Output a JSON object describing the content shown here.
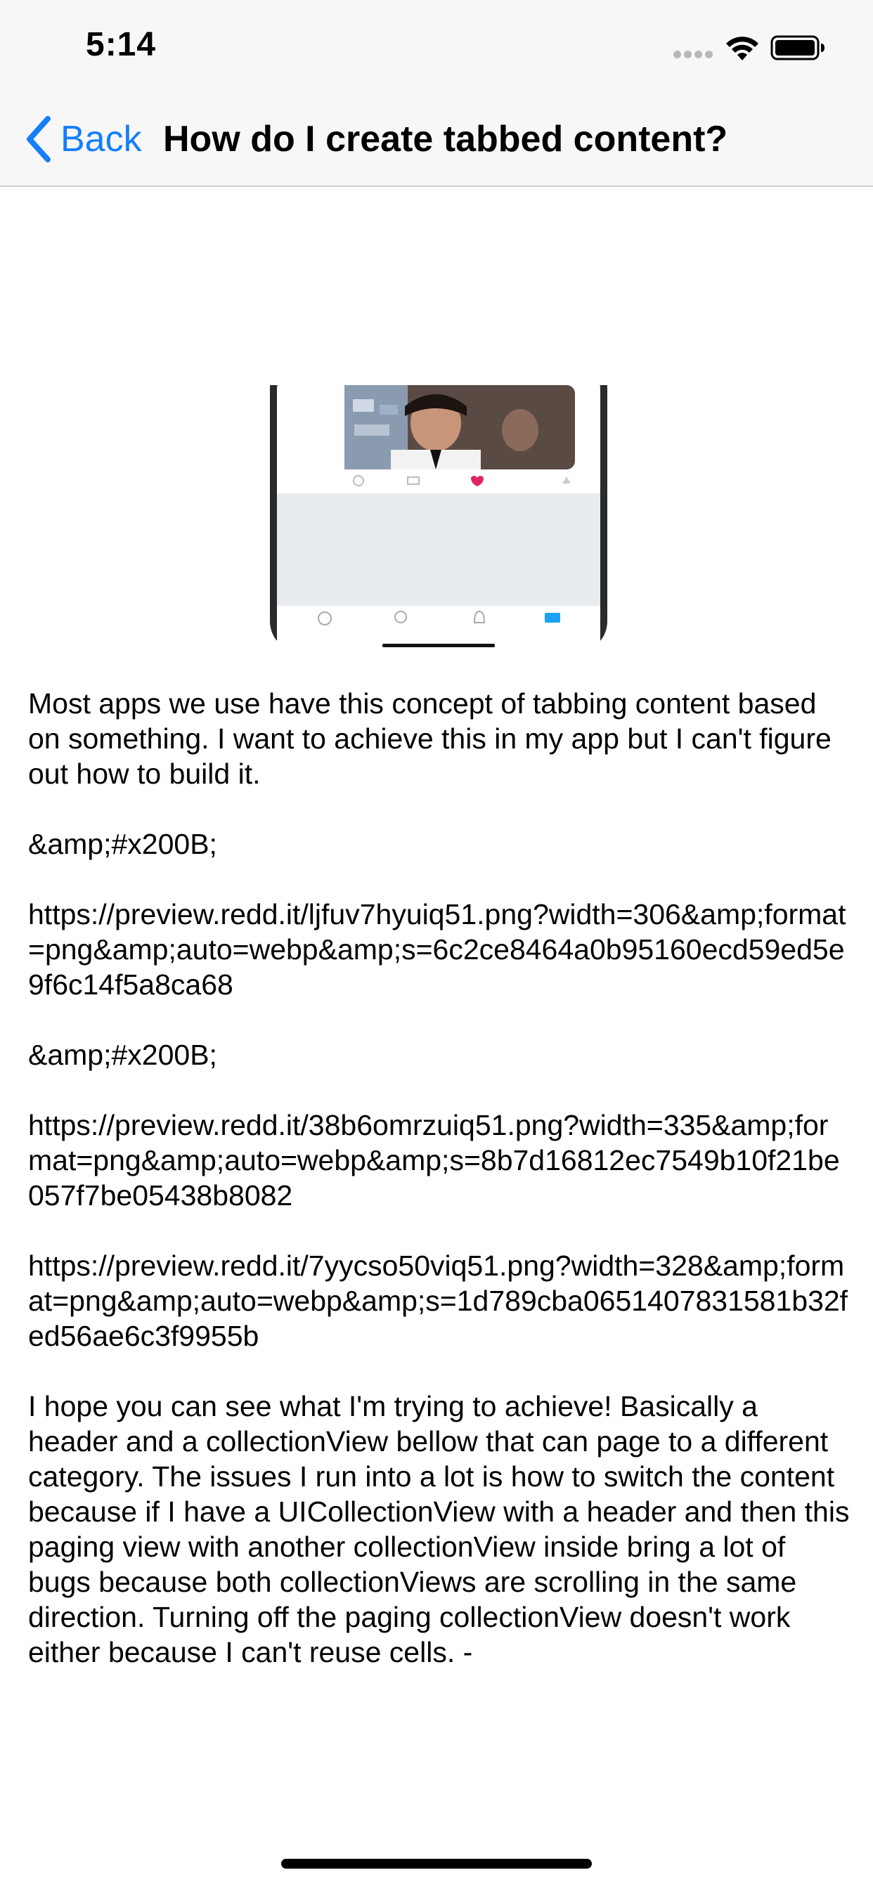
{
  "status_bar": {
    "time": "5:14",
    "icons": [
      "signal-dots-icon",
      "wifi-icon",
      "battery-icon"
    ]
  },
  "nav": {
    "back_label": "Back",
    "title": "How do I create tabbed content?",
    "accent_color": "#157efb"
  },
  "post": {
    "image_alt": "phone-screenshot-image",
    "paragraphs": [
      "Most apps we use have this concept of tabbing content based on something. I want to achieve this in my app but I can't figure out how to build it.",
      "&amp;#x200B;",
      "https://preview.redd.it/ljfuv7hyuiq51.png?width=306&amp;format=png&amp;auto=webp&amp;s=6c2ce8464a0b95160ecd59ed5e9f6c14f5a8ca68",
      "&amp;#x200B;",
      "https://preview.redd.it/38b6omrzuiq51.png?width=335&amp;format=png&amp;auto=webp&amp;s=8b7d16812ec7549b10f21be057f7be05438b8082",
      "https://preview.redd.it/7yycso50viq51.png?width=328&amp;format=png&amp;auto=webp&amp;s=1d789cba0651407831581b32fed56ae6c3f9955b",
      "I hope you can see what I'm trying to achieve! Basically a header and a collectionView bellow that can page to a different category. The issues I run into a lot is how to switch the content because if I have a UICollectionView with a header and then this paging view with another collectionView inside bring a lot of bugs because both collectionViews are scrolling in the same direction. Turning off the paging collectionView doesn't work either because I can't reuse cells. -"
    ]
  }
}
